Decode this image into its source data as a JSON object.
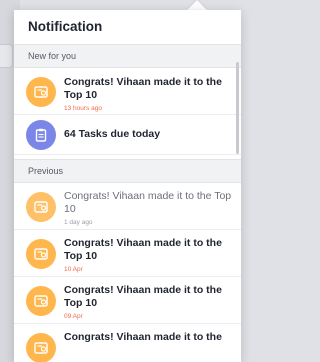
{
  "panel": {
    "title": "Notification"
  },
  "sections": {
    "new_label": "New for you",
    "previous_label": "Previous"
  },
  "new_items": [
    {
      "title": "Congrats! Vihaan made it to the Top 10",
      "time": "13 hours ago",
      "icon": "certificate-icon",
      "color": "#ffb74d"
    },
    {
      "title": "64 Tasks due today",
      "icon": "clipboard-icon",
      "color": "#7b86e6"
    }
  ],
  "previous_items": [
    {
      "title": "Congrats! Vihaan made it to the Top 10",
      "time": "1 day ago",
      "icon": "certificate-icon",
      "color": "#ffb74d"
    },
    {
      "title": "Congrats! Vihaan made it to the Top 10",
      "time": "10 Apr",
      "icon": "certificate-icon",
      "color": "#ffb74d"
    },
    {
      "title": "Congrats! Vihaan made it to the Top 10",
      "time": "09 Apr",
      "icon": "certificate-icon",
      "color": "#ffb74d"
    },
    {
      "title": "Congrats! Vihaan made it to the",
      "icon": "certificate-icon",
      "color": "#ffb74d"
    }
  ]
}
